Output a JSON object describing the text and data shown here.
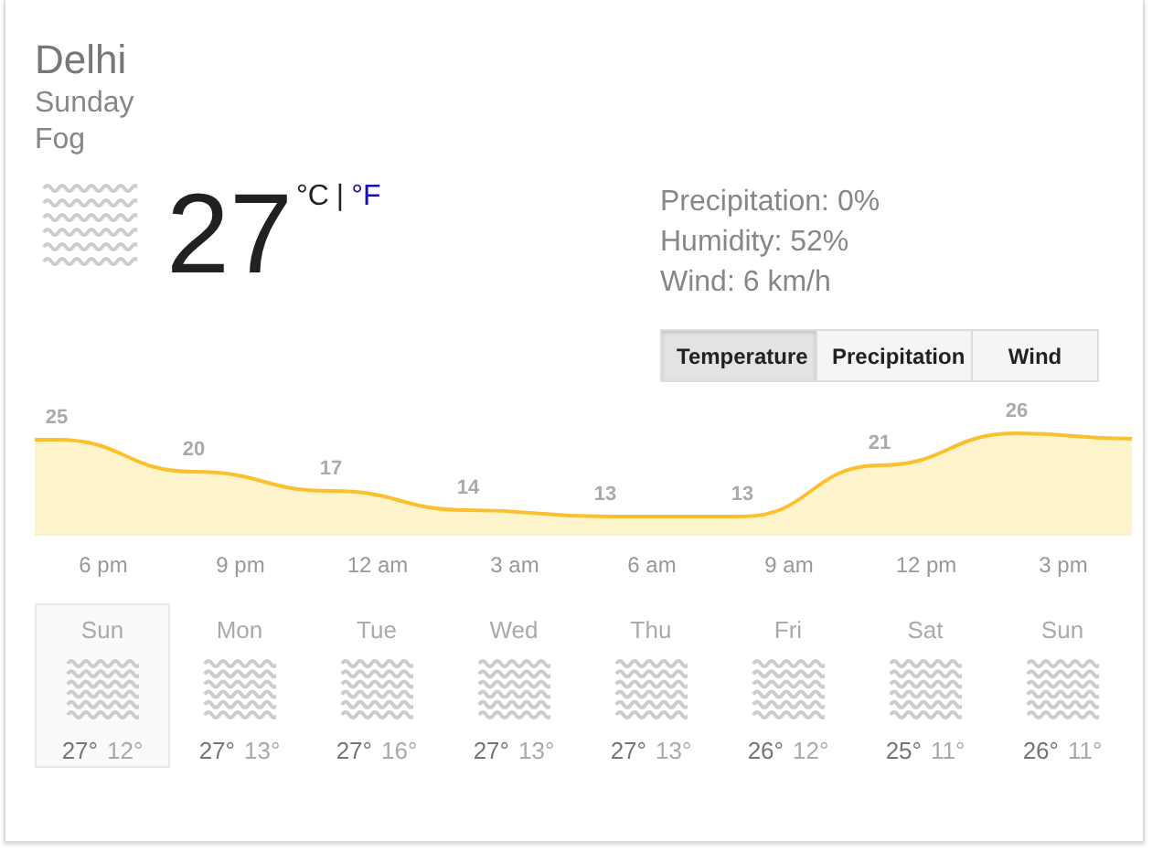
{
  "location": "Delhi",
  "day": "Sunday",
  "condition": "Fog",
  "current": {
    "temperature": "27",
    "unit_celsius": "°C",
    "unit_separator": "|",
    "unit_fahrenheit": "°F"
  },
  "details": [
    "Precipitation: 0%",
    "Humidity: 52%",
    "Wind: 6 km/h"
  ],
  "tabs": [
    {
      "label": "Temperature",
      "selected": true
    },
    {
      "label": "Precipitation",
      "selected": false
    },
    {
      "label": "Wind",
      "selected": false
    }
  ],
  "hourly": [
    {
      "temp": "25",
      "time": "6 pm"
    },
    {
      "temp": "20",
      "time": "9 pm"
    },
    {
      "temp": "17",
      "time": "12 am"
    },
    {
      "temp": "14",
      "time": "3 am"
    },
    {
      "temp": "13",
      "time": "6 am"
    },
    {
      "temp": "13",
      "time": "9 am"
    },
    {
      "temp": "21",
      "time": "12 pm"
    },
    {
      "temp": "26",
      "time": "3 pm"
    }
  ],
  "forecast": [
    {
      "day": "Sun",
      "high": "27°",
      "low": "12°",
      "selected": true
    },
    {
      "day": "Mon",
      "high": "27°",
      "low": "13°",
      "selected": false
    },
    {
      "day": "Tue",
      "high": "27°",
      "low": "16°",
      "selected": false
    },
    {
      "day": "Wed",
      "high": "27°",
      "low": "13°",
      "selected": false
    },
    {
      "day": "Thu",
      "high": "27°",
      "low": "13°",
      "selected": false
    },
    {
      "day": "Fri",
      "high": "26°",
      "low": "12°",
      "selected": false
    },
    {
      "day": "Sat",
      "high": "25°",
      "low": "11°",
      "selected": false
    },
    {
      "day": "Sun",
      "high": "26°",
      "low": "11°",
      "selected": false
    }
  ]
}
